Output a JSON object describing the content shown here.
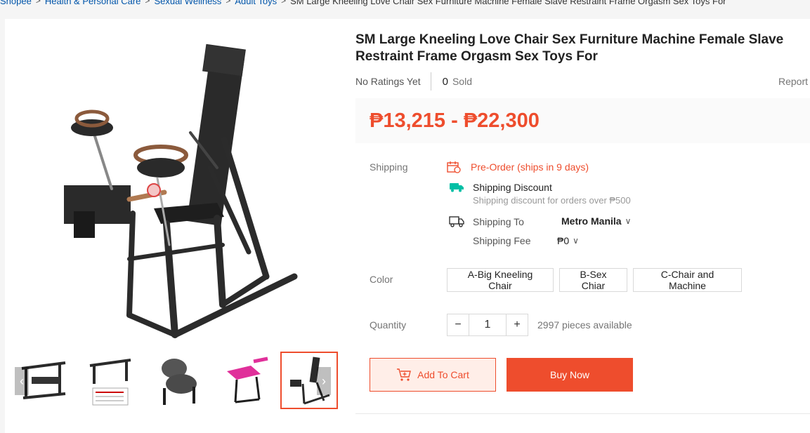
{
  "breadcrumb": {
    "items": [
      "Shopee",
      "Health & Personal Care",
      "Sexual Wellness",
      "Adult Toys"
    ],
    "current": "SM Large Kneeling Love Chair Sex Furniture Machine Female Slave Restraint Frame Orgasm Sex Toys For"
  },
  "product": {
    "title": "SM Large Kneeling Love Chair Sex Furniture Machine Female Slave Restraint Frame Orgasm Sex Toys For",
    "rating_text": "No Ratings Yet",
    "sold_count": "0",
    "sold_label": "Sold",
    "report_label": "Report",
    "price": "₱13,215 - ₱22,300"
  },
  "shipping": {
    "label": "Shipping",
    "preorder": "Pre-Order (ships in 9 days)",
    "discount_title": "Shipping Discount",
    "discount_sub": "Shipping discount for orders over ₱500",
    "to_label": "Shipping To",
    "to_value": "Metro Manila",
    "fee_label": "Shipping Fee",
    "fee_value": "₱0"
  },
  "color": {
    "label": "Color",
    "options": [
      "A-Big Kneeling Chair",
      "B-Sex Chiar",
      "C-Chair and Machine"
    ]
  },
  "quantity": {
    "label": "Quantity",
    "value": "1",
    "available": "2997 pieces available"
  },
  "actions": {
    "add_to_cart": "Add To Cart",
    "buy_now": "Buy Now"
  },
  "colors": {
    "accent": "#ee4d2d",
    "link": "#0055aa"
  }
}
